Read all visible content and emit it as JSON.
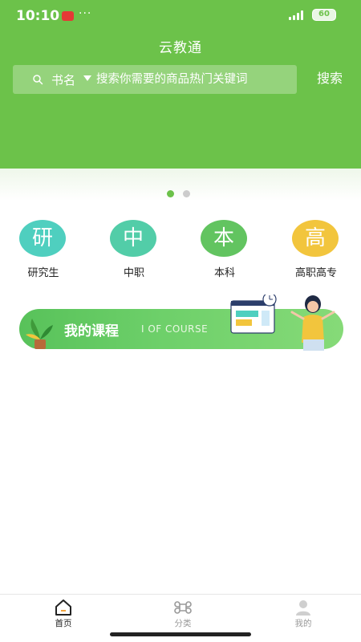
{
  "status_bar": {
    "time": "10:10",
    "more_dots": "···",
    "battery": "60"
  },
  "header": {
    "title": "云教通"
  },
  "search": {
    "category": "书名",
    "placeholder": "搜索你需要的商品热门关键词",
    "button_label": "搜索"
  },
  "carousel": {
    "page_count": 2,
    "active_index": 0
  },
  "categories": [
    {
      "glyph": "研",
      "label": "研究生",
      "color": "#4fcfbf"
    },
    {
      "glyph": "中",
      "label": "中职",
      "color": "#52cda8"
    },
    {
      "glyph": "本",
      "label": "本科",
      "color": "#62c460"
    },
    {
      "glyph": "高",
      "label": "高职高专",
      "color": "#f2c53d"
    }
  ],
  "course_banner": {
    "title": "我的课程",
    "subtitle": "I OF COURSE"
  },
  "tabbar": {
    "items": [
      {
        "label": "首页",
        "icon": "home-icon",
        "active": true
      },
      {
        "label": "分类",
        "icon": "command-icon",
        "active": false
      },
      {
        "label": "我的",
        "icon": "user-icon",
        "active": false
      }
    ]
  },
  "colors": {
    "brand_green": "#6cc24a",
    "active_dot": "#6cc24a",
    "inactive_dot": "#cccccc",
    "tab_active": "#222222",
    "tab_inactive": "#999999"
  }
}
